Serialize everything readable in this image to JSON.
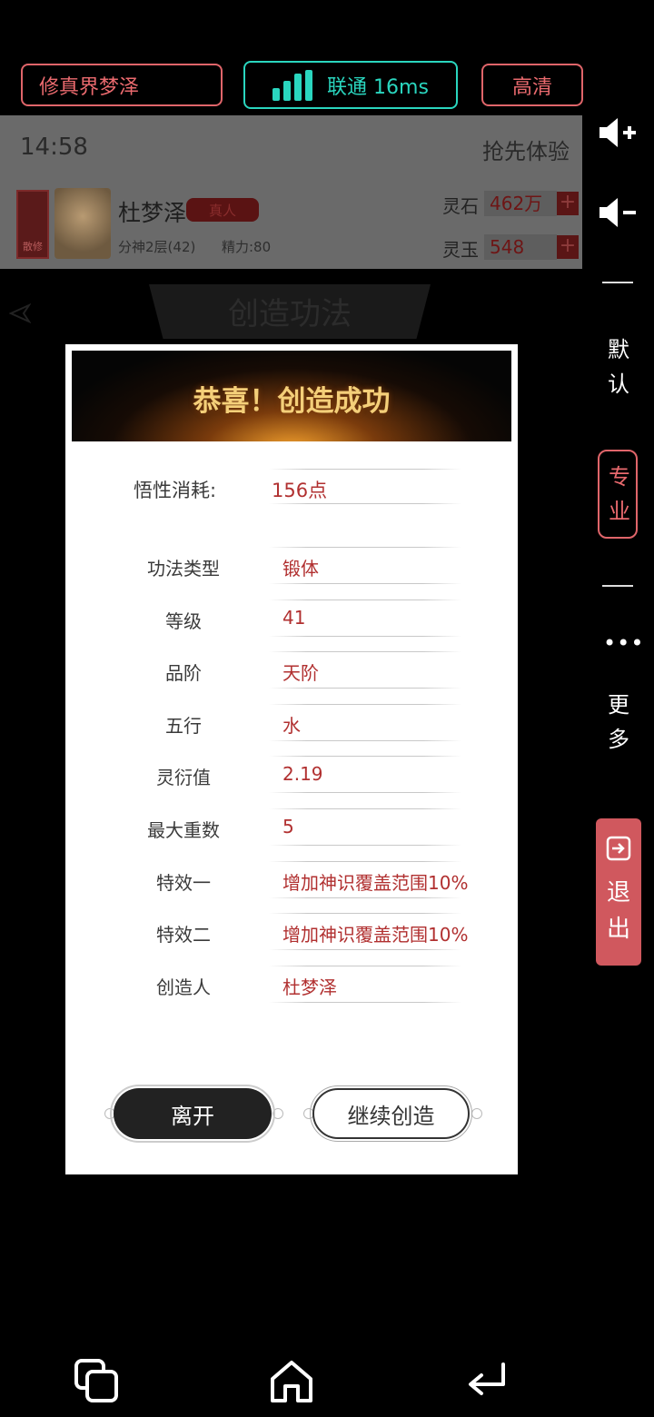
{
  "topbar": {
    "title_button": "修真界梦泽",
    "network_label": "联通 16ms",
    "quality_button": "高清"
  },
  "game_header": {
    "time": "14:58",
    "promo": "抢先体验",
    "seal_text": "散修",
    "player_name": "杜梦泽",
    "badge": "真人",
    "realm": "分神2层(42)",
    "energy": "精力:80",
    "resources": [
      {
        "label": "灵石",
        "value": "462万",
        "plus": "+"
      },
      {
        "label": "灵玉",
        "value": "548",
        "plus": "+"
      }
    ]
  },
  "page": {
    "title": "创造功法"
  },
  "sidebar": {
    "mode_default": "默认",
    "mode_pro": "专业",
    "more_dots": "•••",
    "more": "更多",
    "exit": "退出"
  },
  "modal": {
    "title": "恭喜！创造成功",
    "cost_label": "悟性消耗:",
    "cost_value": "156点",
    "rows": [
      {
        "label": "功法类型",
        "value": "锻体"
      },
      {
        "label": "等级",
        "value": "41"
      },
      {
        "label": "品阶",
        "value": "天阶"
      },
      {
        "label": "五行",
        "value": "水"
      },
      {
        "label": "灵衍值",
        "value": "2.19"
      },
      {
        "label": "最大重数",
        "value": "5"
      },
      {
        "label": "特效一",
        "value": "增加神识覆盖范围10%"
      },
      {
        "label": "特效二",
        "value": "增加神识覆盖范围10%"
      },
      {
        "label": "创造人",
        "value": "杜梦泽"
      }
    ],
    "leave_button": "离开",
    "continue_button": "继续创造"
  },
  "colors": {
    "accent_red": "#e0656a",
    "network_teal": "#2ad6bf",
    "value_red": "#b13030",
    "exit_bg": "#d0585e"
  },
  "icons": [
    "volume-up-icon",
    "volume-down-icon",
    "exit-icon",
    "recent-apps-icon",
    "home-icon",
    "back-icon",
    "signal-bars-icon",
    "back-arrow-icon"
  ]
}
